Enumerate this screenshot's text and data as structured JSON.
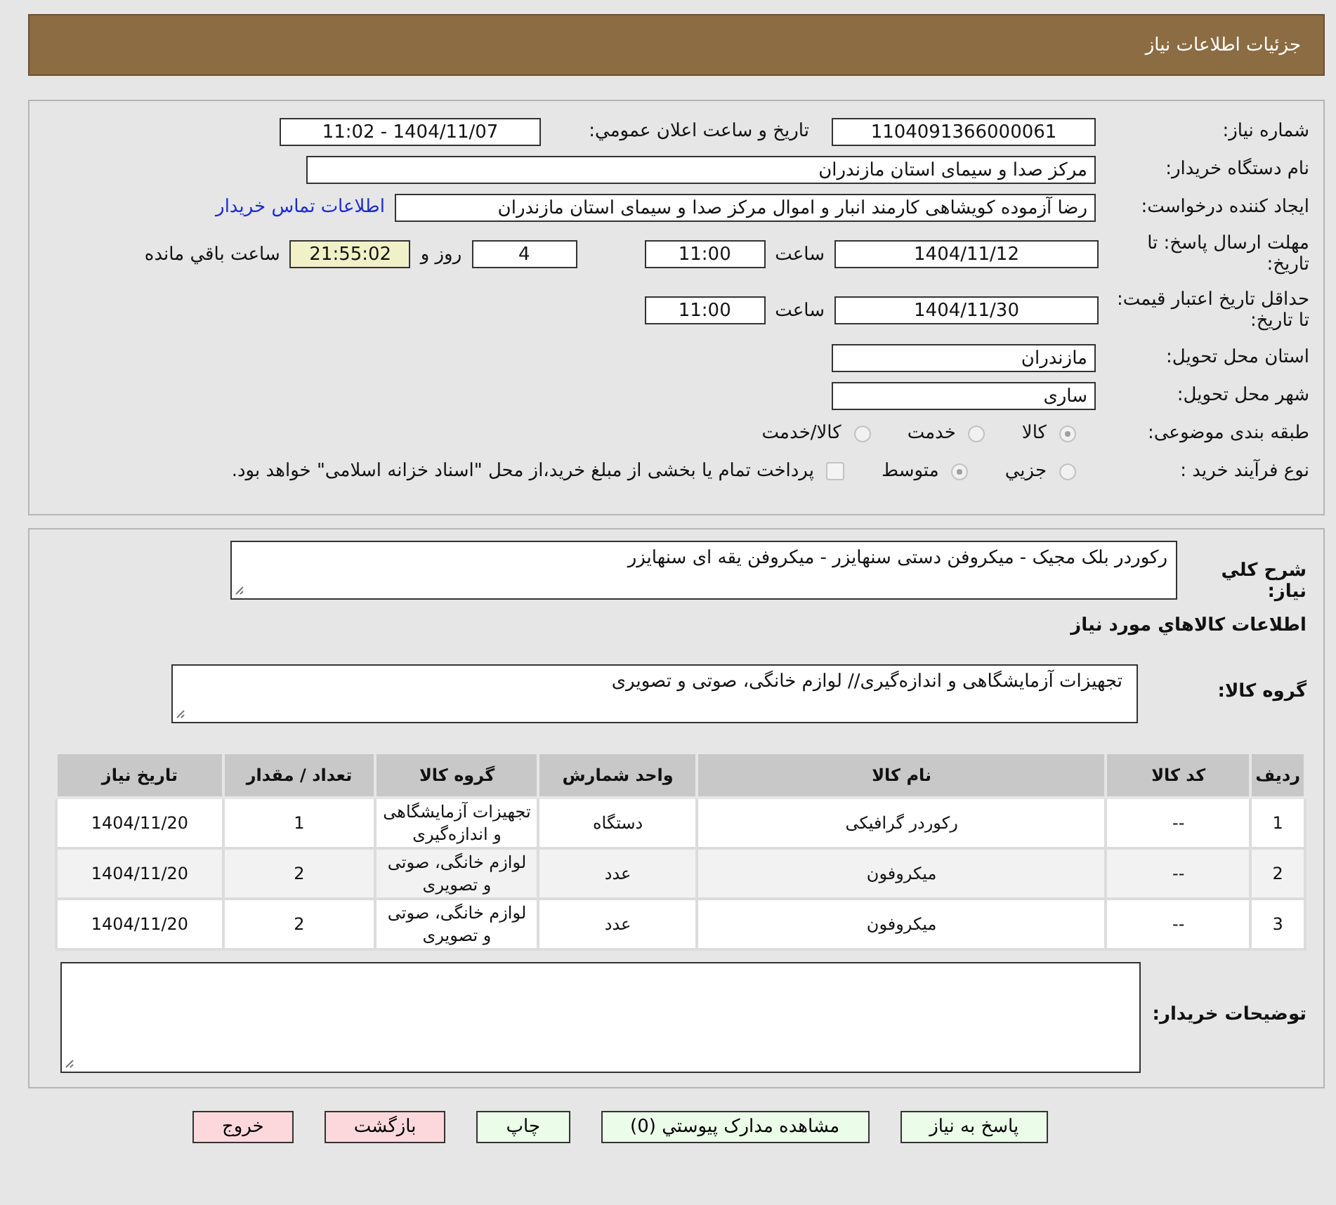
{
  "header": {
    "title": "جزئیات اطلاعات نیاز"
  },
  "need_number": {
    "label": "شماره نیاز:",
    "value": "1104091366000061"
  },
  "announce": {
    "label": "تاریخ و ساعت اعلان عمومي:",
    "value": "1404/11/07 - 11:02"
  },
  "buyer_org": {
    "label": "نام دستگاه خريدار:",
    "value": "مرکز صدا و سیمای استان مازندران"
  },
  "requester": {
    "label": "ايجاد کننده درخواست:",
    "value": "رضا آزموده کویشاهی کارمند انبار و اموال مرکز صدا و سیمای استان مازندران",
    "link": "اطلاعات تماس خريدار"
  },
  "reply_deadline": {
    "label": "مهلت ارسال پاسخ: تا تاریخ:",
    "date": "1404/11/12",
    "time_label": "ساعت",
    "time": "11:00",
    "days": "4",
    "days_label": "روز و",
    "remaining": "21:55:02",
    "remaining_label": "ساعت باقي مانده"
  },
  "price_validity": {
    "label": "حداقل تاریخ اعتبار قیمت: تا تاریخ:",
    "date": "1404/11/30",
    "time_label": "ساعت",
    "time": "11:00"
  },
  "province": {
    "label": "استان محل تحويل:",
    "value": "مازندران"
  },
  "city": {
    "label": "شهر محل تحويل:",
    "value": "ساری"
  },
  "category": {
    "label": "طبقه بندی موضوعی:",
    "options": [
      {
        "label": "کالا",
        "selected": true
      },
      {
        "label": "خدمت",
        "selected": false
      },
      {
        "label": "کالا/خدمت",
        "selected": false
      }
    ]
  },
  "process": {
    "label": "نوع فرآیند خرید :",
    "options": [
      {
        "label": "جزيي",
        "selected": false
      },
      {
        "label": "متوسط",
        "selected": true
      }
    ],
    "payment": {
      "checked": false,
      "text": "پرداخت تمام یا بخشی از مبلغ خرید،از محل \"اسناد خزانه اسلامی\" خواهد بود."
    }
  },
  "summary": {
    "label": "شرح كلي نياز:",
    "value": "رکوردر بلک مجیک - میکروفن دستی سنهایزر - میکروفن یقه ای سنهایزر"
  },
  "goods_title": "اطلاعات كالاهاي مورد نياز",
  "goods_group": {
    "label": "گروه کالا:",
    "value": "تجهیزات آزمایشگاهی و اندازه‌گیری// لوازم خانگی، صوتی و تصویری"
  },
  "table": {
    "columns": [
      "رديف",
      "کد کالا",
      "نام کالا",
      "واحد شمارش",
      "گروه کالا",
      "تعداد / مقدار",
      "تاریخ نیاز"
    ],
    "rows": [
      [
        "1",
        "--",
        "رکوردر گرافیکی",
        "دستگاه",
        "تجهیزات آزمایشگاهی و اندازه‌گیری",
        "1",
        "1404/11/20"
      ],
      [
        "2",
        "--",
        "میکروفون",
        "عدد",
        "لوازم خانگی، صوتی و تصویری",
        "2",
        "1404/11/20"
      ],
      [
        "3",
        "--",
        "میکروفون",
        "عدد",
        "لوازم خانگی، صوتی و تصویری",
        "2",
        "1404/11/20"
      ]
    ]
  },
  "buyer_notes": {
    "label": "توضيحات خريدار:"
  },
  "buttons": [
    {
      "label": "پاسخ به نیاز",
      "kind": "normal"
    },
    {
      "label": "مشاهده مدارک پیوستي (0)",
      "kind": "normal"
    },
    {
      "label": "چاپ",
      "kind": "normal"
    },
    {
      "label": "بازگشت",
      "kind": "danger"
    },
    {
      "label": "خروج",
      "kind": "danger"
    }
  ]
}
